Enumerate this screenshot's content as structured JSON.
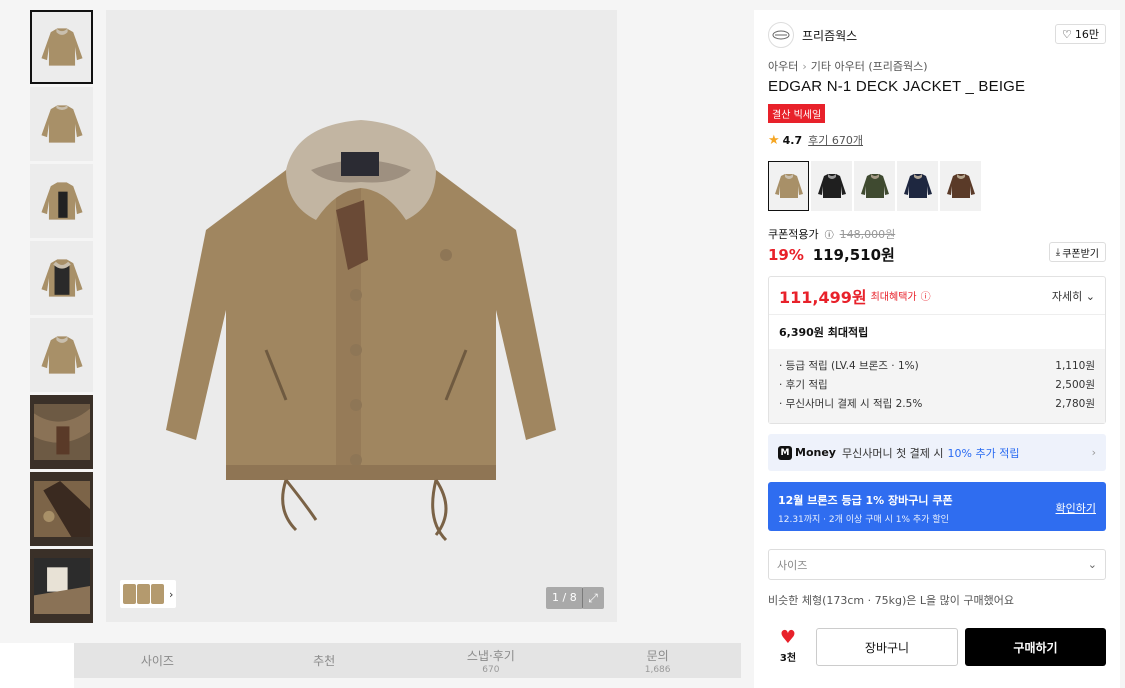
{
  "gallery": {
    "pager": "1 / 8",
    "thumbnails": [
      "thumb-1",
      "thumb-2",
      "thumb-3",
      "thumb-4",
      "thumb-5",
      "thumb-6",
      "thumb-7",
      "thumb-8"
    ]
  },
  "tabs": [
    {
      "label": "사이즈",
      "sub": ""
    },
    {
      "label": "추천",
      "sub": ""
    },
    {
      "label": "스냅·후기",
      "sub": "670"
    },
    {
      "label": "문의",
      "sub": "1,686"
    }
  ],
  "brand": {
    "name": "프리즘웍스",
    "likes": "16만"
  },
  "breadcrumb": {
    "first": "아우터",
    "second": "기타 아우터 (프리즘웍스)"
  },
  "product": {
    "title": "EDGAR N-1 DECK JACKET _ BEIGE",
    "badge": "결산 빅세일",
    "rating": "4.7",
    "reviews": "후기 670개"
  },
  "colors": {
    "swatches": [
      "#a89068",
      "#1f1f1f",
      "#3f4a30",
      "#1e2740",
      "#5a3a28"
    ]
  },
  "price": {
    "label": "쿠폰적용가",
    "original": "148,000원",
    "discount": "19%",
    "current": "119,510원",
    "coupon_button": "쿠폰받기"
  },
  "benefit": {
    "max_price": "111,499원",
    "max_tag": "최대혜택가",
    "detail": "자세히",
    "points_title": "6,390원 최대적립",
    "rows": [
      {
        "label": "· 등급 적립 (LV.4 브론즈 · 1%)",
        "value": "1,110원"
      },
      {
        "label": "· 후기 적립",
        "value": "2,500원"
      },
      {
        "label": "· 무신사머니 결제 시 적립 2.5%",
        "value": "2,780원"
      }
    ]
  },
  "money": {
    "icon": "M",
    "brand": "Money",
    "text": "무신사머니 첫 결제 시",
    "highlight": "10% 추가 적립"
  },
  "promo": {
    "title": "12월 브론즈 등급 1% 장바구니 쿠폰",
    "subtitle": "12.31까지 · 2개 이상 구매 시 1% 추가 할인",
    "link": "확인하기"
  },
  "size": {
    "placeholder": "사이즈",
    "hint": "비슷한 체형(173cm · 75kg)은 L을 많이 구매했어요"
  },
  "actions": {
    "like_count": "3천",
    "cart": "장바구니",
    "buy": "구매하기"
  }
}
